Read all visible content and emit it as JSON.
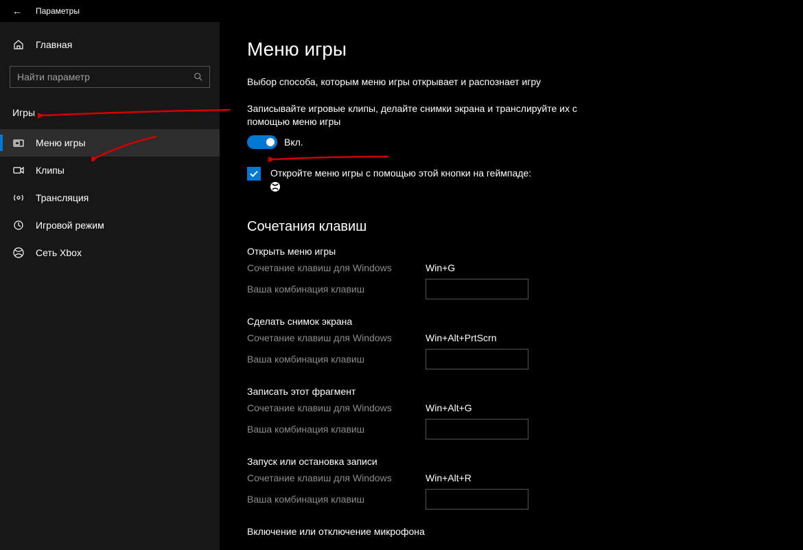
{
  "titlebar": {
    "appname": "Параметры"
  },
  "sidebar": {
    "home": "Главная",
    "search_placeholder": "Найти параметр",
    "section_label": "Игры",
    "items": [
      {
        "label": "Меню игры"
      },
      {
        "label": "Клипы"
      },
      {
        "label": "Трансляция"
      },
      {
        "label": "Игровой режим"
      },
      {
        "label": "Сеть Xbox"
      }
    ]
  },
  "content": {
    "title": "Меню игры",
    "intro": "Выбор способа, которым меню игры открывает и распознает игру",
    "toggle_desc": "Записывайте игровые клипы, делайте снимки экрана и транслируйте их с помощью меню игры",
    "toggle_value": "Вкл.",
    "checkbox_text": "Откройте меню игры с помощью этой кнопки на геймпаде:",
    "hotkeys_title": "Сочетания клавиш",
    "groups": [
      {
        "name": "Открыть меню игры",
        "win_label": "Сочетание клавиш для Windows",
        "win_value": "Win+G",
        "user_label": "Ваша комбинация клавиш"
      },
      {
        "name": "Сделать снимок экрана",
        "win_label": "Сочетание клавиш для Windows",
        "win_value": "Win+Alt+PrtScrn",
        "user_label": "Ваша комбинация клавиш"
      },
      {
        "name": "Записать этот фрагмент",
        "win_label": "Сочетание клавиш для Windows",
        "win_value": "Win+Alt+G",
        "user_label": "Ваша комбинация клавиш"
      },
      {
        "name": "Запуск или остановка записи",
        "win_label": "Сочетание клавиш для Windows",
        "win_value": "Win+Alt+R",
        "user_label": "Ваша комбинация клавиш"
      }
    ],
    "mic_title": "Включение или отключение микрофона"
  }
}
